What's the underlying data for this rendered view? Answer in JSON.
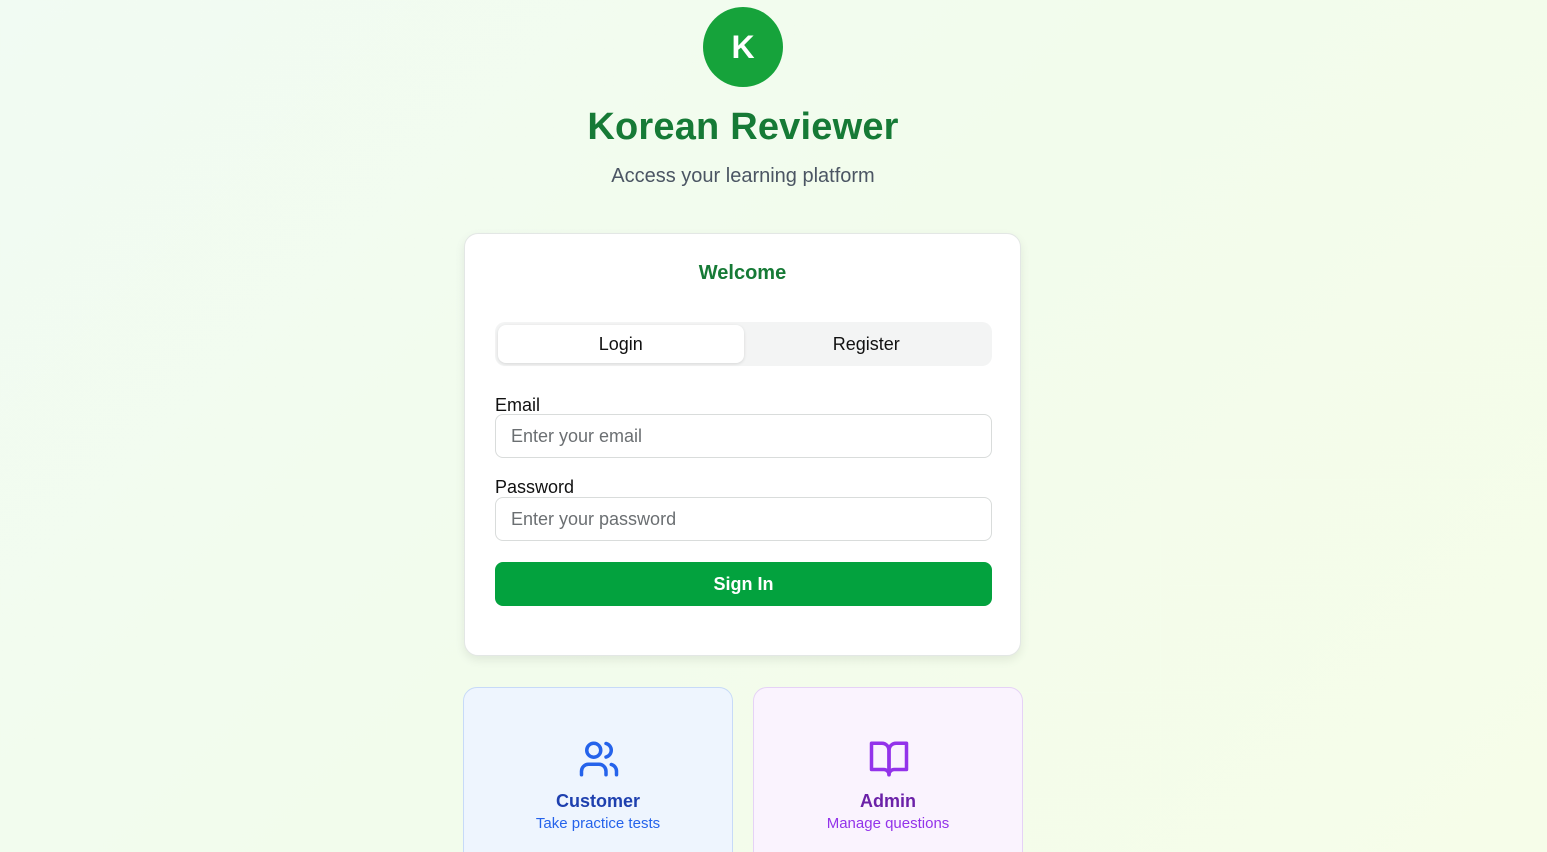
{
  "header": {
    "logo_letter": "K",
    "title": "Korean Reviewer",
    "subtitle": "Access your learning platform"
  },
  "card": {
    "title": "Welcome",
    "tabs": [
      {
        "label": "Login",
        "active": true
      },
      {
        "label": "Register",
        "active": false
      }
    ],
    "email": {
      "label": "Email",
      "placeholder": "Enter your email",
      "value": ""
    },
    "password": {
      "label": "Password",
      "placeholder": "Enter your password",
      "value": ""
    },
    "submit_label": "Sign In"
  },
  "roles": [
    {
      "name": "Customer",
      "description": "Take practice tests",
      "icon": "users-icon"
    },
    {
      "name": "Admin",
      "description": "Manage questions",
      "icon": "book-open-icon"
    }
  ],
  "colors": {
    "brand_green": "#16a33b",
    "title_green": "#167a36",
    "button_green": "#03a23e",
    "customer_blue": "#2563eb",
    "admin_purple": "#9333ea"
  }
}
